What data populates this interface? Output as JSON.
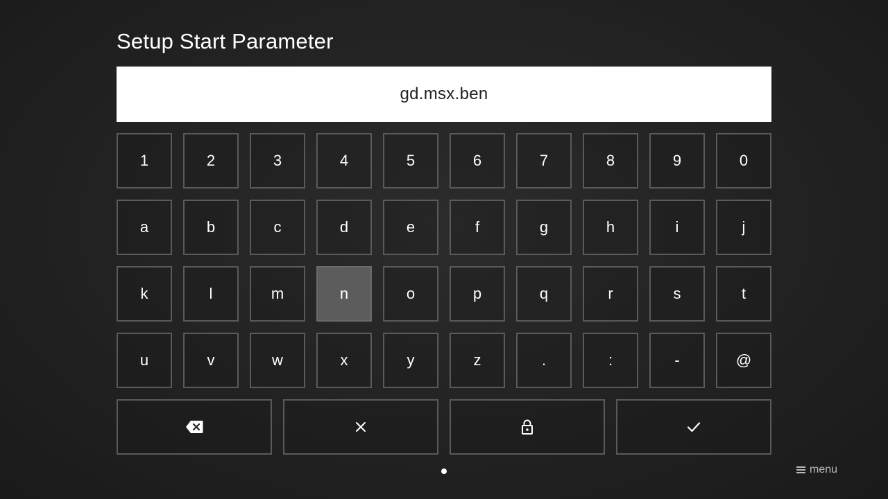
{
  "title": "Setup Start Parameter",
  "input": {
    "value": "gd.msx.ben"
  },
  "keyboard": {
    "rows": [
      [
        "1",
        "2",
        "3",
        "4",
        "5",
        "6",
        "7",
        "8",
        "9",
        "0"
      ],
      [
        "a",
        "b",
        "c",
        "d",
        "e",
        "f",
        "g",
        "h",
        "i",
        "j"
      ],
      [
        "k",
        "l",
        "m",
        "n",
        "o",
        "p",
        "q",
        "r",
        "s",
        "t"
      ],
      [
        "u",
        "v",
        "w",
        "x",
        "y",
        "z",
        ".",
        ":",
        "-",
        "@"
      ]
    ],
    "focused_key": "n",
    "actions": [
      {
        "name": "backspace",
        "icon": "backspace-icon"
      },
      {
        "name": "clear",
        "icon": "close-icon"
      },
      {
        "name": "lock",
        "icon": "lock-icon"
      },
      {
        "name": "confirm",
        "icon": "checkmark-icon"
      }
    ]
  },
  "pagination": {
    "pages": 1,
    "current": 1
  },
  "menu": {
    "label": "menu",
    "icon": "hamburger-icon"
  },
  "colors": {
    "background": "#222222",
    "key_border": "#5a5a5a",
    "focused_key": "#5c5c5c",
    "input_background": "#ffffff"
  }
}
